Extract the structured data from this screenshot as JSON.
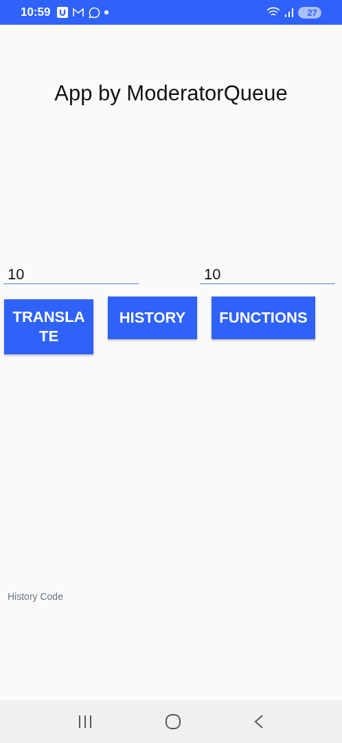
{
  "status_bar": {
    "time": "10:59",
    "battery": "27"
  },
  "title": "App by ModeratorQueue",
  "fields": [
    {
      "value": "10"
    },
    {
      "value": "10"
    }
  ],
  "buttons": [
    {
      "label": "TRANSLATE"
    },
    {
      "label": "HISTORY"
    },
    {
      "label": "FUNCTIONS"
    }
  ],
  "footer_label": "History Code"
}
